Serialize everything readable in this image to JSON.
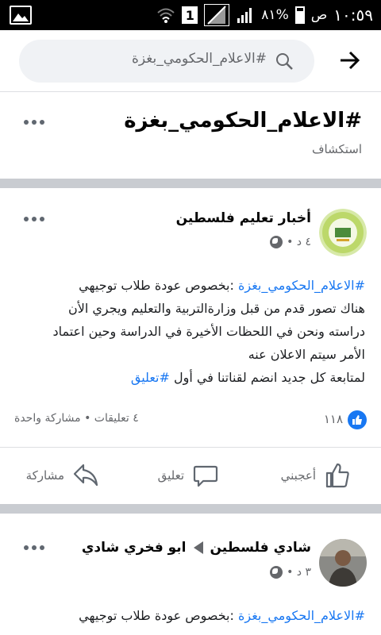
{
  "status_bar": {
    "battery_percent": "٨١%",
    "time": "١٠:٥٩",
    "am_pm": "ص",
    "sim_label": "1"
  },
  "search": {
    "query": "#الاعلام_الحكومي_بغزة"
  },
  "topic": {
    "title": "#الاعلام_الحكومي_بغزة",
    "subtitle": "استكشاف"
  },
  "posts": [
    {
      "author": "أخبار تعليم فلسطين",
      "meta": "٤ د •",
      "hashtag": "#الاعلام_الحكومي_بغزة",
      "line1_rest": " :بخصوص عودة طلاب توجيهي",
      "line2": "هناك تصور قدم من قبل وزارةالتربية والتعليم ويجري الأن",
      "line3": "دراسته ونحن في اللحظات الأخيرة في الدراسة وحين اعتماد",
      "line4": "الأمر سيتم الاعلان عنه",
      "line5_text": "لمتابعة كل جديد انضم لقناتنا في أول ",
      "line5_hashtag": "#تعليق",
      "likes": "١١٨",
      "engagement": "٤ تعليقات • مشاركة واحدة",
      "actions": {
        "like": "أعجبني",
        "comment": "تعليق",
        "share": "مشاركة"
      }
    },
    {
      "author_from": "ابو فخري شادي",
      "author_to": "شادي فلسطين",
      "meta": "٣ د •",
      "hashtag": "#الاعلام_الحكومي_بغزة",
      "line1_rest": " :بخصوص عودة طلاب توجيهي"
    }
  ],
  "colors": {
    "accent": "#1877f2",
    "divider": "#c9ccd1",
    "secondary_text": "#65676b"
  }
}
